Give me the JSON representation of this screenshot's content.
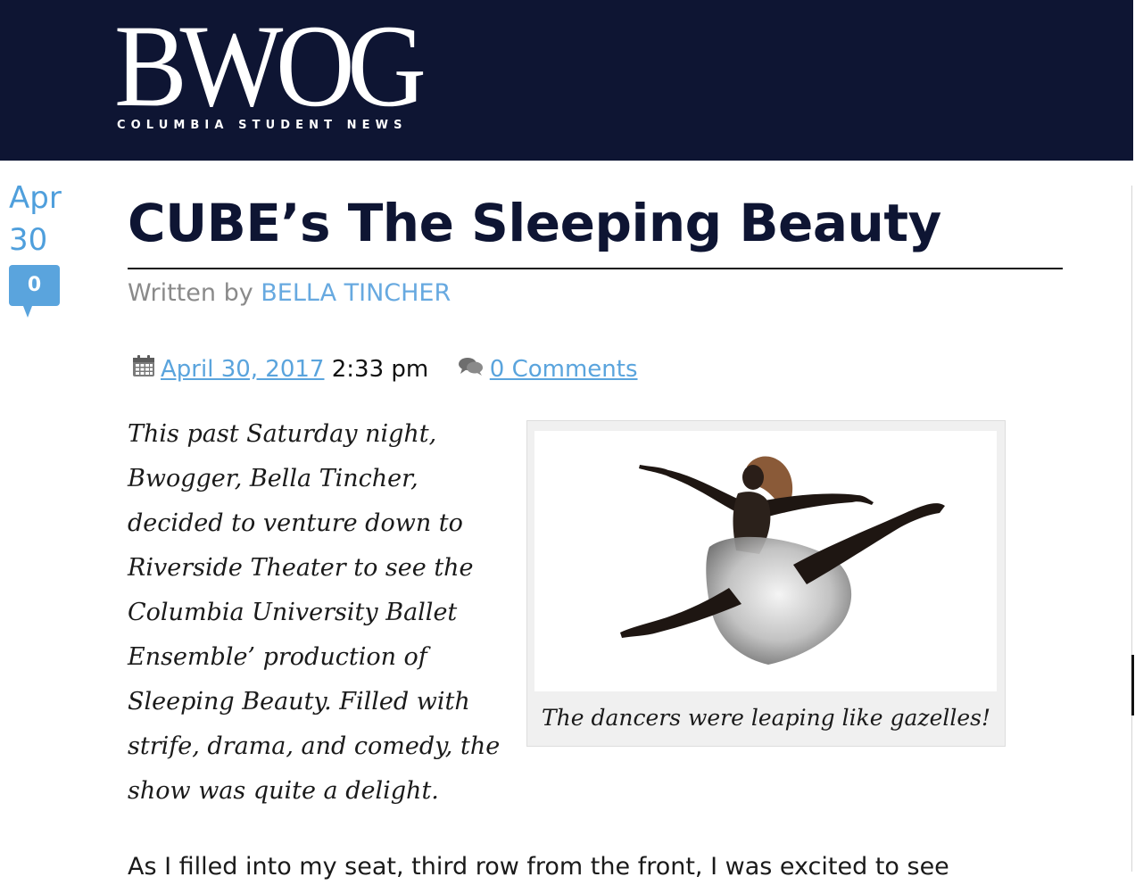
{
  "header": {
    "logo_text": "BWOG",
    "tagline": "COLUMBIA STUDENT NEWS",
    "background_color": "#0e1533"
  },
  "post_date_badge": {
    "month": "Apr",
    "day": "30",
    "comment_count": "0",
    "accent_color": "#4f9fdc"
  },
  "article": {
    "title": "CUBE’s The Sleeping Beauty",
    "byline_prefix": "Written by",
    "author": "BELLA TINCHER",
    "date_link": "April 30, 2017",
    "time": "2:33 pm",
    "comments_link": "0 Comments",
    "lede": "This past Saturday night, Bwogger, Bella Tincher, decided to venture down to Riverside Theater to see the Columbia University Ballet Ensemble’ production of Sleeping Beauty. Filled with strife, drama, and comedy, the show was quite a delight.",
    "body_first_line": "As I filled into my seat, third row from the front, I was excited to see"
  },
  "figure": {
    "image_subject": "ballerina-leap-silhouette",
    "caption": "The dancers were leaping like gazelles!"
  },
  "icons": {
    "calendar": "calendar-icon",
    "comments": "speech-bubbles-icon"
  },
  "link_color": "#5aa4dd"
}
